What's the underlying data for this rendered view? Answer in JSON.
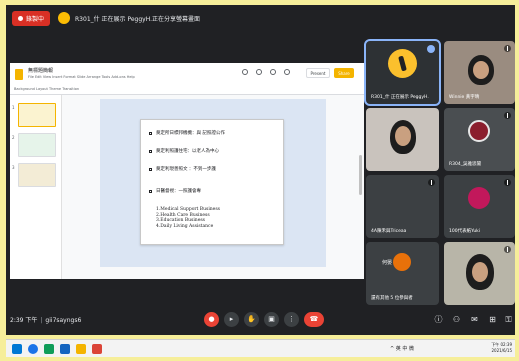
{
  "banner": {
    "recording_label": "錄製中",
    "presenter_label": "R301_什 正在展示 PeggyH.正在分享螢幕畫面"
  },
  "slides": {
    "doc_title": "無標題簡報",
    "menu_text": "File Edit View Insert Format Slide Arrange Tools Add-ons Help",
    "toolbar_text": "Background   Layout   Theme   Transition",
    "slideshow_label": "Present",
    "share_label": "Share",
    "thumbnail_numbers": [
      "1",
      "2",
      "3"
    ],
    "bullets": [
      "奠定所日標邦機機：與 記照證公作",
      "奠定利照護住宅：以老人為中心",
      "奠定利現善照文 ：不到一步護",
      "日醫督視：一照護會專"
    ],
    "sub_items": [
      "1.Medical Support Business",
      "2.Health Care Business",
      "3.Education Business",
      "4.Daily Living Assistance"
    ]
  },
  "participants": [
    {
      "name": "R301_什 正在展示 PeggyH.",
      "avatar": "yellow-avatar"
    },
    {
      "name": "Winnie 黃宇晴",
      "avatar": "video"
    },
    {
      "name": "",
      "avatar": "video"
    },
    {
      "name": "R304_吳雅思聞",
      "avatar": "photo"
    },
    {
      "name": "4A陳禾與Triceaa",
      "avatar": "none"
    },
    {
      "name": "100代表紙Yuki",
      "avatar": "picture"
    },
    {
      "name": "還有其他 5 位參與者",
      "avatar": "orange-avatar",
      "overlay": "何晏"
    },
    {
      "name": "",
      "avatar": "video"
    }
  ],
  "controls": {
    "time": "2:39 下午",
    "meeting_code": "gii7sayngs6"
  },
  "taskbar": {
    "tray_text": "^ 英 中 微",
    "time": "下午 02:39",
    "date": "2021/6/15"
  },
  "colors": {
    "meet_bg": "#202124",
    "end_call": "#ea4335",
    "slides_yellow": "#f4b400",
    "accent_blue": "#8ab4f8"
  }
}
